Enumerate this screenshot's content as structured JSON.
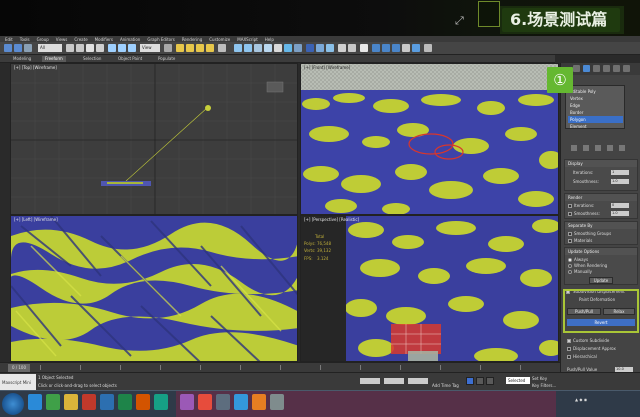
{
  "banner": {
    "title": "6.场景测试篇"
  },
  "menu": {
    "items": [
      "Edit",
      "Tools",
      "Group",
      "Views",
      "Create",
      "Modifiers",
      "Animation",
      "Graph Editors",
      "Rendering",
      "Customize",
      "MAXScript",
      "Help"
    ]
  },
  "toolbar": {
    "selection_filter": "All",
    "view_combo": "View"
  },
  "ribbon": {
    "tabs": [
      "Modeling",
      "Freeform",
      "Selection",
      "Object Paint",
      "Populate"
    ],
    "active": "Freeform"
  },
  "viewports": {
    "top_label": "[+] [Top] [Wireframe]",
    "front_label": "[+] [Front] [Wireframe]",
    "left_label": "[+] [Left] [Wireframe]",
    "persp_label": "[+] [Perspective] [Realistic]",
    "stats": {
      "total_label": "Total",
      "polys_label": "Polys:",
      "polys_value": "76,548",
      "verts_label": "Verts:",
      "verts_value": "39,132",
      "fps_label": "FPS:",
      "fps_value": "3.124"
    }
  },
  "command_panel": {
    "badge": "①",
    "modifier_list": [
      "Editable Poly",
      "Vertex",
      "Edge",
      "Border",
      "Polygon",
      "Element"
    ],
    "selected_modifier": "Polygon",
    "display": {
      "header": "Display",
      "iterations_label": "Iterations:",
      "iterations_value": "1",
      "smoothness_label": "Smoothness:",
      "smoothness_value": "1.0"
    },
    "render": {
      "header": "Render",
      "iterations_label": "Iterations:",
      "iterations_value": "0",
      "smoothness_label": "Smoothness:",
      "smoothness_value": "1.0"
    },
    "separate_by": {
      "header": "Separate By",
      "smoothing_groups": "Smoothing Groups",
      "materials": "Materials"
    },
    "update_options": {
      "header": "Update Options",
      "always": "Always",
      "when_rendering": "When Rendering",
      "manually": "Manually",
      "update_button": "Update"
    },
    "subdivision_displacement": {
      "header": "Subdivision Displacement",
      "preset_header": "Paint Deformation",
      "push_pull": "Push/Pull",
      "relax": "Relax",
      "revert": "Revert",
      "subdivision_surface": "Custom Subdivide",
      "displacement_approx": "Displacement Approx",
      "hierarchical": "Hierarchical",
      "push_pull_value_label": "Push/Pull Value",
      "push_pull_value": "10.0"
    }
  },
  "timeline": {
    "frame": "0 / 100"
  },
  "status": {
    "maxscript_label": "Maxscript Mini",
    "selected": "1 Object Selected",
    "prompt": "Click or click-and-drag to select objects",
    "add_time_tag": "Add Time Tag",
    "auto_key": "Selected",
    "set_key": "Set Key",
    "key_filters": "Key Filters..."
  }
}
